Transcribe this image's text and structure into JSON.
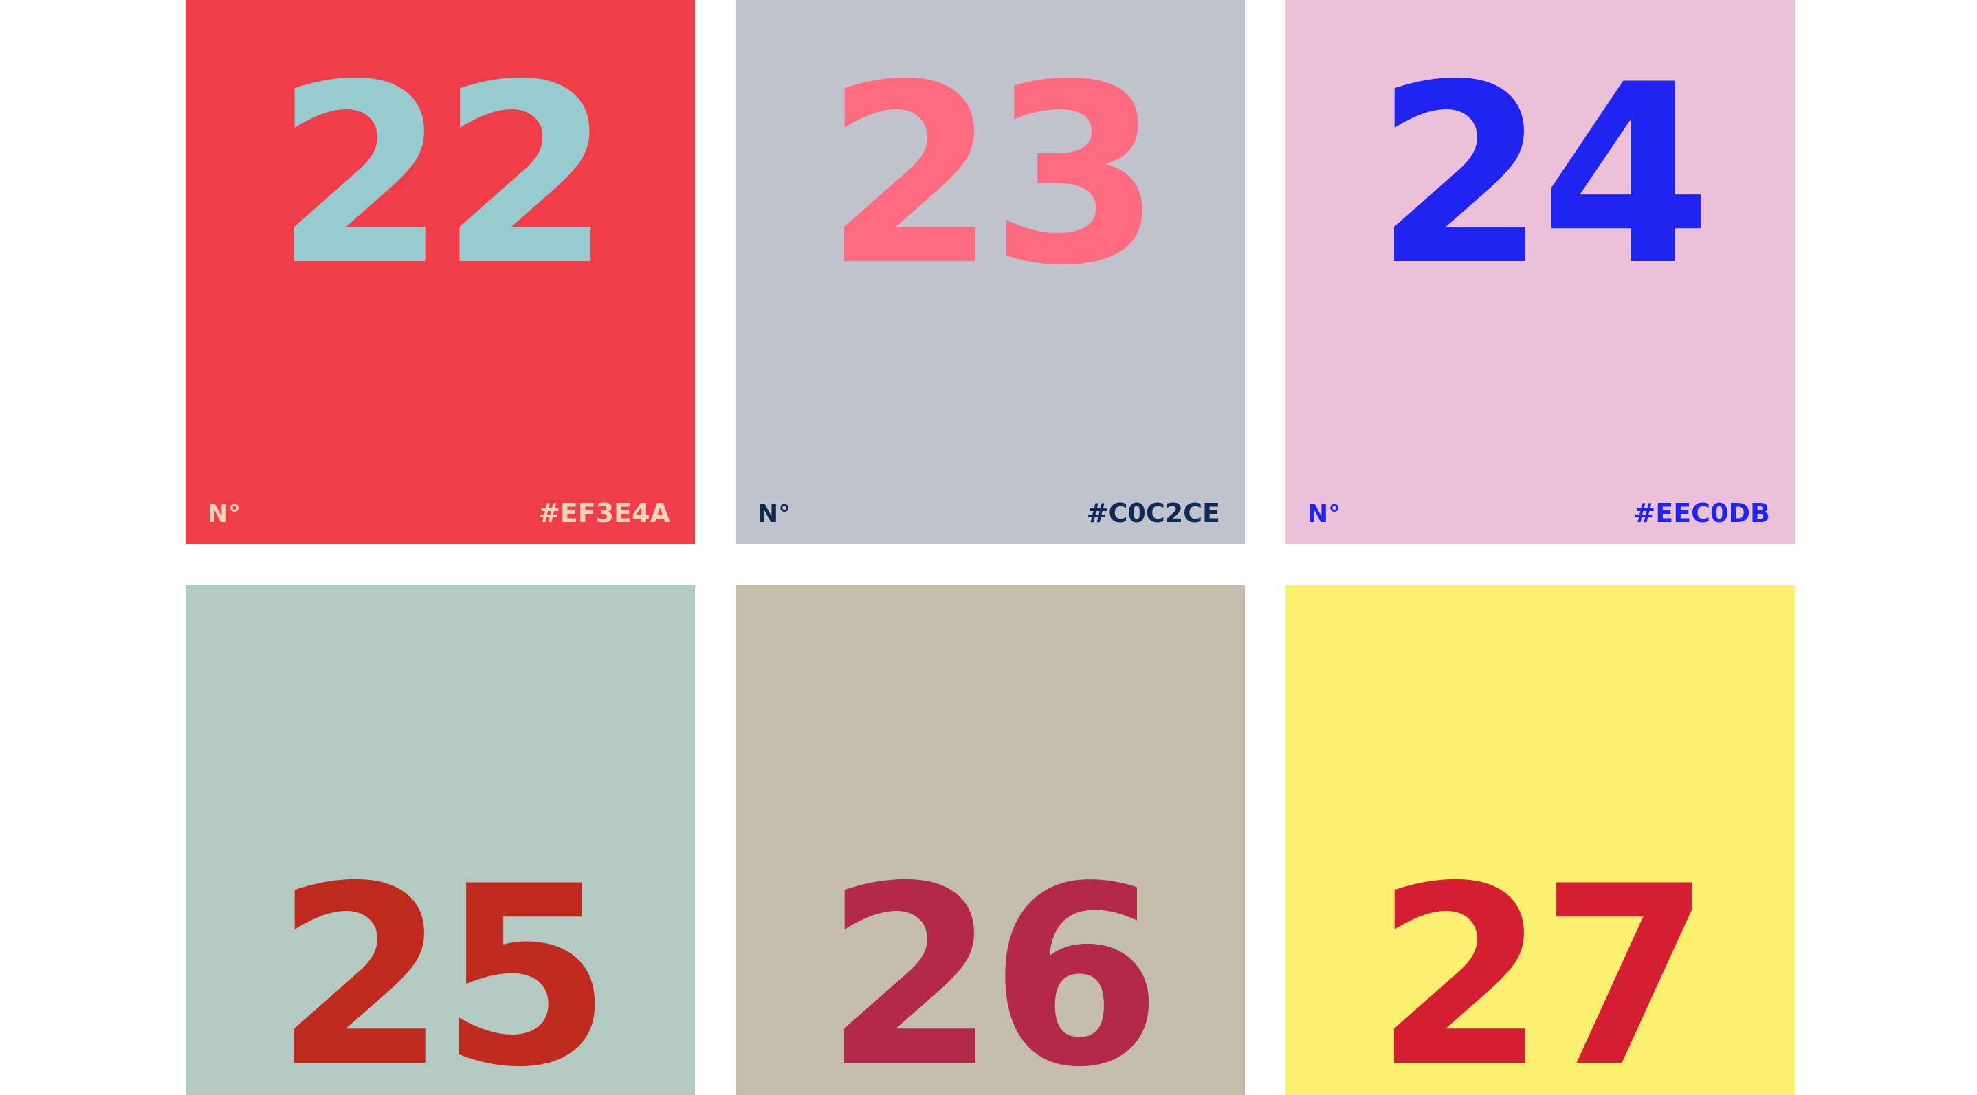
{
  "cards": [
    {
      "number": "22",
      "no_label": "N°",
      "hex_label": "#EF3E4A",
      "bg": "#EF3E4A",
      "fg": "#98CBD0",
      "label_color": "#F5D4B8"
    },
    {
      "number": "23",
      "no_label": "N°",
      "hex_label": "#C0C2CE",
      "bg": "#C0C2CE",
      "fg": "#FF6B81",
      "label_color": "#0F2A52"
    },
    {
      "number": "24",
      "no_label": "N°",
      "hex_label": "#EEC0DB",
      "bg": "#EDC0DA",
      "fg": "#1F24F0",
      "label_color": "#1F24F0"
    },
    {
      "number": "25",
      "bg": "#B3CAC2",
      "fg": "#C0291D"
    },
    {
      "number": "26",
      "bg": "#C4BDAA",
      "fg": "#B32949"
    },
    {
      "number": "27",
      "bg": "#FBEF70",
      "fg": "#D41F33"
    }
  ]
}
